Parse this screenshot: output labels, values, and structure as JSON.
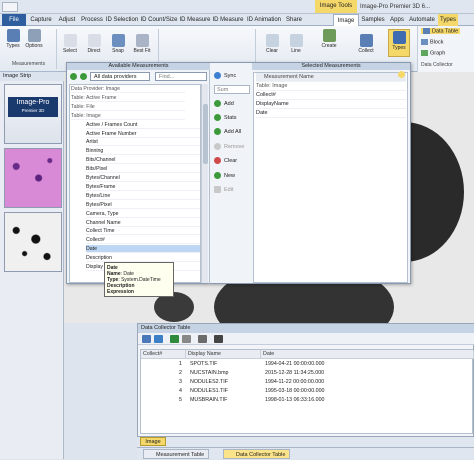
{
  "title_bar": {
    "context_tab": "Image Tools",
    "app_title": "Image-Pro Premier 3D 6..."
  },
  "tabs": [
    "File",
    "Capture",
    "Adjust",
    "Process",
    "ID Selection",
    "ID Count/Size",
    "ID Measure",
    "ID Measure",
    "ID Animation",
    "Share",
    "Image",
    "Samples",
    "Apps",
    "Automate",
    "Types"
  ],
  "ribbon": {
    "buttons": [
      "Types",
      "Options",
      "Select",
      "Direct",
      "Snap",
      "Best Fit",
      "Clear",
      "Profile",
      "Line",
      "Create",
      "Collect",
      "Types"
    ],
    "group_labels": [
      "Measurements",
      "Data Collector"
    ],
    "data_collector": {
      "data_table": "Data Table",
      "block": "Block",
      "graph": "Graph"
    }
  },
  "image_strip": {
    "title": "Image Strip",
    "thumb1_text": "Image-Pro",
    "thumb1_sub": "Premier 3D"
  },
  "dialog": {
    "available_title": "Available Measurements",
    "selected_title": "Selected Measurements",
    "provider_value": "All data providers",
    "find_placeholder": "Find...",
    "available_items": [
      {
        "text": "Data Provider: Image",
        "header": true
      },
      {
        "text": "Table: Active Frame",
        "header": true
      },
      {
        "text": "Table: File",
        "header": true
      },
      {
        "text": "Table: Image",
        "header": true
      },
      {
        "text": "Active / Frames Count",
        "header": false
      },
      {
        "text": "Active Frame Number",
        "header": false
      },
      {
        "text": "Artist",
        "header": false
      },
      {
        "text": "Binning",
        "header": false
      },
      {
        "text": "Bits/Channel",
        "header": false
      },
      {
        "text": "Bits/Pixel",
        "header": false
      },
      {
        "text": "Bytes/Channel",
        "header": false
      },
      {
        "text": "Bytes/Frame",
        "header": false
      },
      {
        "text": "Bytes/Line",
        "header": false
      },
      {
        "text": "Bytes/Pixel",
        "header": false
      },
      {
        "text": "Camera, Type",
        "header": false
      },
      {
        "text": "Channel Name",
        "header": false
      },
      {
        "text": "Collect Time",
        "header": false
      },
      {
        "text": "Collect#",
        "header": false
      },
      {
        "text": "Date",
        "header": false,
        "selected": true
      },
      {
        "text": "Description",
        "header": false
      },
      {
        "text": "Display Name",
        "header": false
      }
    ],
    "sync_label": "Sync",
    "sum_value": "Sum",
    "mid_buttons": [
      "Add",
      "Stats",
      "Add All",
      "Remove",
      "Clear",
      "New",
      "Edit"
    ],
    "selected_header": "Measurement Name",
    "selected_table": "Table: Image",
    "selected_items": [
      "Collect#",
      "DisplayName",
      "Date"
    ]
  },
  "tooltip": {
    "title": "Date",
    "name_label": "Name",
    "name_value": "Date",
    "type_label": "Type",
    "type_value": "System.DateTime",
    "desc_label": "Description",
    "expr_label": "Expression"
  },
  "data_collector": {
    "title": "Data Collector Table",
    "columns": [
      "Collect#",
      "Display Name",
      "Date"
    ],
    "rows": [
      [
        "1",
        "SPOTS.TIF",
        "1994-04-21 00:00:00.000"
      ],
      [
        "2",
        "NUCSTAIN.bmp",
        "2015-12-28 11:34:25.000"
      ],
      [
        "3",
        "NODULES2.TIF",
        "1994-11-22 00:00:00.000"
      ],
      [
        "4",
        "NODULES1.TIF",
        "1995-03-18 00:00:00.000"
      ],
      [
        "5",
        "MUSBRAIN.TIF",
        "1998-01-13 06:33:16.000"
      ]
    ]
  },
  "image_tab": "Image",
  "bottom_tabs": [
    "Measurement Table",
    "Data Collector Table"
  ],
  "colors": {
    "accent": "#f4d86a",
    "file_tab": "#2e5e9e",
    "selection": "#bcd6f3"
  }
}
